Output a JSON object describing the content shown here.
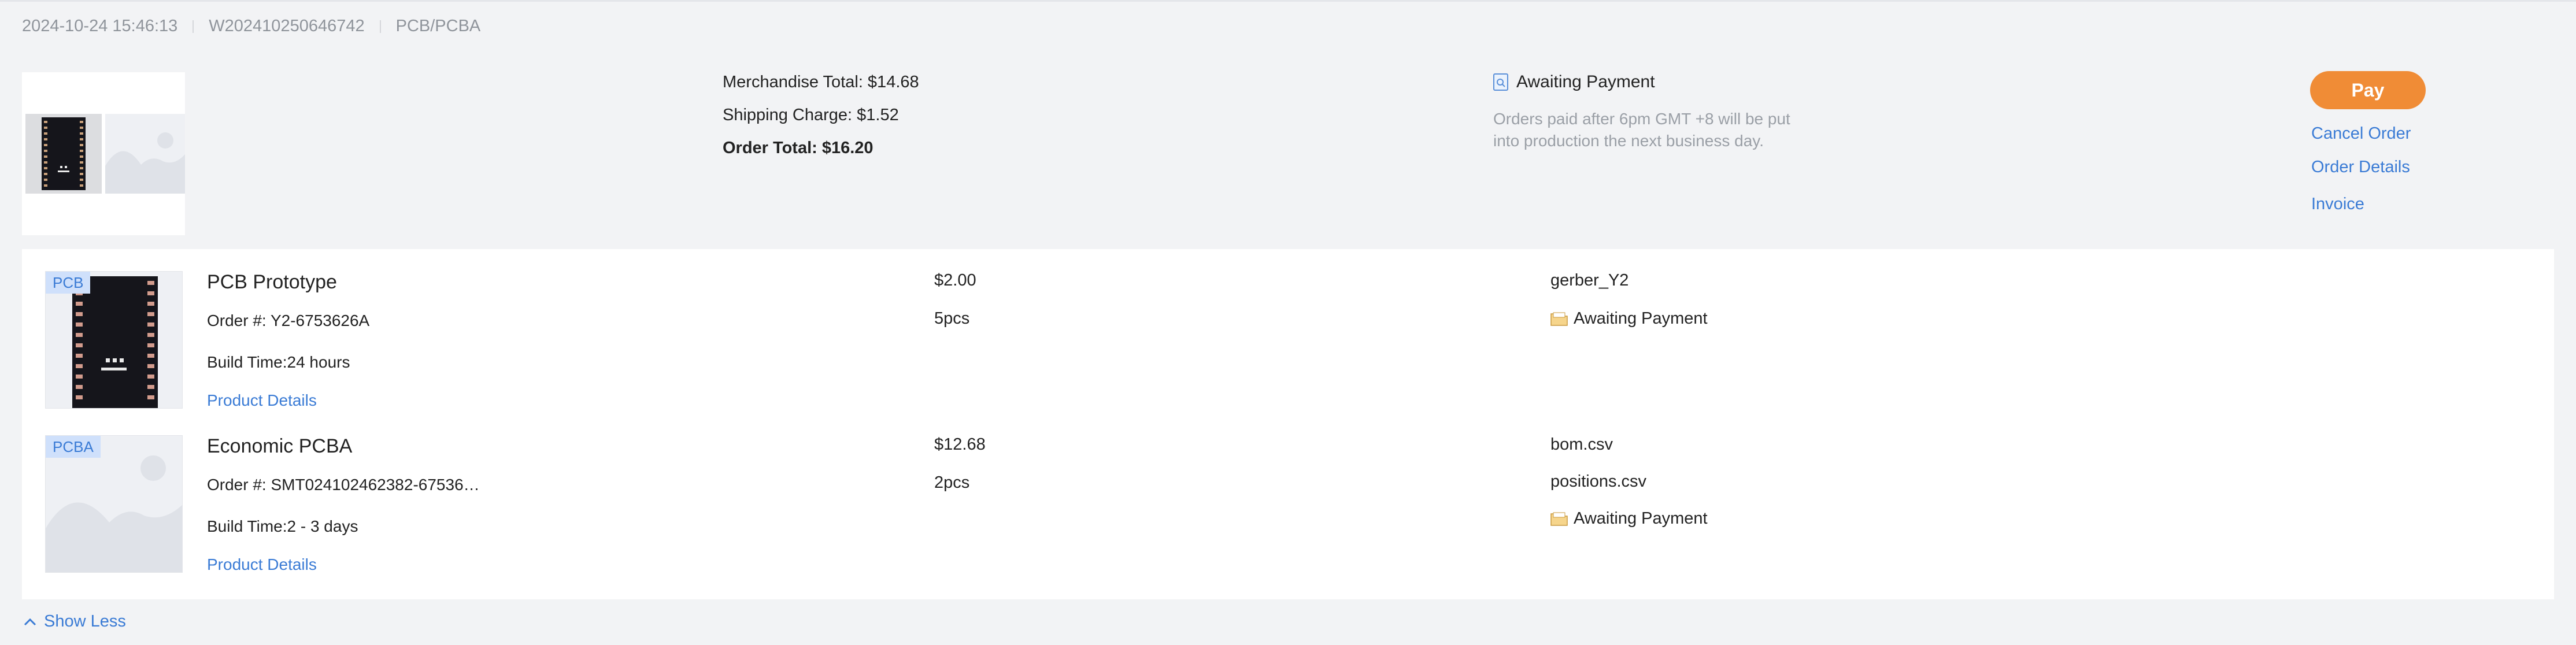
{
  "order": {
    "datetime": "2024-10-24 15:46:13",
    "order_id": "W202410250646742",
    "category": "PCB/PCBA"
  },
  "summary": {
    "merchandise_total": "Merchandise Total: $14.68",
    "shipping_charge": "Shipping Charge: $1.52",
    "order_total": "Order Total: $16.20",
    "status": "Awaiting Payment",
    "status_icon": "document-search-icon",
    "note": "Orders paid after 6pm GMT +8 will be put into production the next business day."
  },
  "actions": {
    "pay": "Pay",
    "cancel": "Cancel Order",
    "details": "Order Details",
    "invoice": "Invoice"
  },
  "items": [
    {
      "tag": "PCB",
      "title": "PCB Prototype",
      "order_number": "Order #: Y2-6753626A",
      "build_time": "Build Time:24 hours",
      "details_link": "Product Details",
      "price": "$2.00",
      "quantity": "5pcs",
      "files": [
        "gerber_Y2"
      ],
      "status": "Awaiting Payment"
    },
    {
      "tag": "PCBA",
      "title": "Economic PCBA",
      "order_number": "Order #: SMT024102462382-67536…",
      "build_time": "Build Time:2 - 3 days",
      "details_link": "Product Details",
      "price": "$12.68",
      "quantity": "2pcs",
      "files": [
        "bom.csv",
        "positions.csv"
      ],
      "status": "Awaiting Payment"
    }
  ],
  "footer": {
    "show_less": "Show Less"
  },
  "colors": {
    "accent": "#f08c36",
    "link": "#3a7bd5",
    "muted": "#9a9fa6",
    "background": "#f2f3f5"
  }
}
